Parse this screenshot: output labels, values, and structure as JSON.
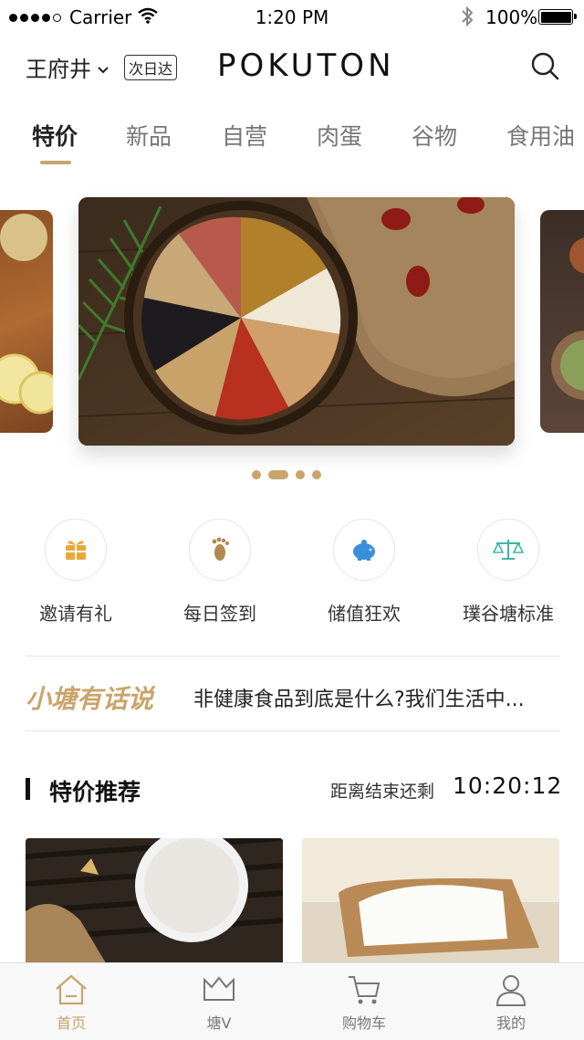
{
  "status_bar": {
    "carrier": "Carrier",
    "time": "1:20 PM",
    "battery": "100%"
  },
  "header": {
    "location": "王府井",
    "delivery_badge": "次日达",
    "logo": "POKUTON"
  },
  "tabs": [
    {
      "label": "特价",
      "active": true
    },
    {
      "label": "新品"
    },
    {
      "label": "自营"
    },
    {
      "label": "肉蛋"
    },
    {
      "label": "谷物"
    },
    {
      "label": "食用油"
    }
  ],
  "carousel": {
    "page_count": 4,
    "active_index": 1
  },
  "shortcuts": [
    {
      "label": "邀请有礼",
      "icon": "gift-icon",
      "color": "#e8a93a"
    },
    {
      "label": "每日签到",
      "icon": "footprint-icon",
      "color": "#b08a4e"
    },
    {
      "label": "储值狂欢",
      "icon": "piggy-bank-icon",
      "color": "#3a8fd9"
    },
    {
      "label": "璞谷塘标准",
      "icon": "scale-icon",
      "color": "#3bb8a0"
    }
  ],
  "news": {
    "tag": "小塘有话说",
    "headline": "非健康食品到底是什么?我们生活中..."
  },
  "special": {
    "title": "特价推荐",
    "countdown_label": "距离结束还剩",
    "countdown": "10:20:12"
  },
  "bottom_nav": [
    {
      "label": "首页",
      "icon": "home-icon",
      "active": true
    },
    {
      "label": "塘V",
      "icon": "crown-icon"
    },
    {
      "label": "购物车",
      "icon": "cart-icon"
    },
    {
      "label": "我的",
      "icon": "user-icon"
    }
  ],
  "colors": {
    "accent": "#c9a46b"
  }
}
